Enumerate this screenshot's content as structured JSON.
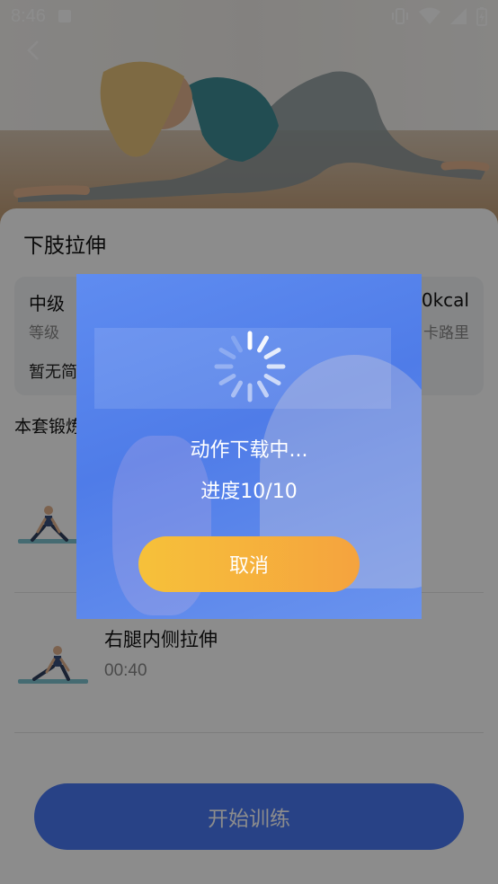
{
  "status_bar": {
    "time": "8:46"
  },
  "workout": {
    "title": "下肢拉伸",
    "level_value": "中级",
    "level_label": "等级",
    "kcal_value": "0kcal",
    "kcal_label": "卡路里",
    "description": "暂无简",
    "section_title": "本套锻炼"
  },
  "exercises": [
    {
      "name": "",
      "duration": ""
    },
    {
      "name": "右腿内侧拉伸",
      "duration": "00:40"
    }
  ],
  "start_button": "开始训练",
  "dialog": {
    "status": "动作下载中...",
    "progress": "进度10/10",
    "progress_value": 1.0,
    "cancel": "取消"
  },
  "colors": {
    "primary": "#4a78f4",
    "cancel_start": "#f6c13a",
    "cancel_end": "#f5a33e"
  }
}
